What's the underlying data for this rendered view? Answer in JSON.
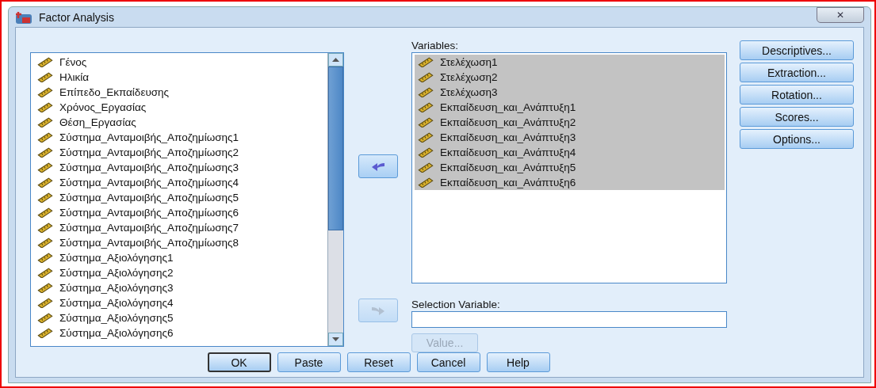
{
  "window": {
    "title": "Factor Analysis",
    "close": "✕"
  },
  "source_list": {
    "items": [
      {
        "label": "Γένος",
        "selected": false
      },
      {
        "label": "Ηλικία",
        "selected": false
      },
      {
        "label": "Επίπεδο_Εκπαίδευσης",
        "selected": false
      },
      {
        "label": "Χρόνος_Εργασίας",
        "selected": false
      },
      {
        "label": "Θέση_Εργασίας",
        "selected": false
      },
      {
        "label": "Σύστημα_Ανταμοιβής_Αποζημίωσης1",
        "selected": false
      },
      {
        "label": "Σύστημα_Ανταμοιβής_Αποζημίωσης2",
        "selected": false
      },
      {
        "label": "Σύστημα_Ανταμοιβής_Αποζημίωσης3",
        "selected": false
      },
      {
        "label": "Σύστημα_Ανταμοιβής_Αποζημίωσης4",
        "selected": false
      },
      {
        "label": "Σύστημα_Ανταμοιβής_Αποζημίωσης5",
        "selected": false
      },
      {
        "label": "Σύστημα_Ανταμοιβής_Αποζημίωσης6",
        "selected": false
      },
      {
        "label": "Σύστημα_Ανταμοιβής_Αποζημίωσης7",
        "selected": false
      },
      {
        "label": "Σύστημα_Ανταμοιβής_Αποζημίωσης8",
        "selected": false
      },
      {
        "label": "Σύστημα_Αξιολόγησης1",
        "selected": false
      },
      {
        "label": "Σύστημα_Αξιολόγησης2",
        "selected": false
      },
      {
        "label": "Σύστημα_Αξιολόγησης3",
        "selected": false
      },
      {
        "label": "Σύστημα_Αξιολόγησης4",
        "selected": false
      },
      {
        "label": "Σύστημα_Αξιολόγησης5",
        "selected": false
      },
      {
        "label": "Σύστημα_Αξιολόγησης6",
        "selected": false
      }
    ]
  },
  "move_in_button": {
    "disabled": false
  },
  "variables": {
    "label": "Variables:",
    "items": [
      {
        "label": "Στελέχωση1",
        "selected": true
      },
      {
        "label": "Στελέχωση2",
        "selected": true
      },
      {
        "label": "Στελέχωση3",
        "selected": true
      },
      {
        "label": "Εκπαίδευση_και_Ανάπτυξη1",
        "selected": true
      },
      {
        "label": "Εκπαίδευση_και_Ανάπτυξη2",
        "selected": true
      },
      {
        "label": "Εκπαίδευση_και_Ανάπτυξη3",
        "selected": true
      },
      {
        "label": "Εκπαίδευση_και_Ανάπτυξη4",
        "selected": true
      },
      {
        "label": "Εκπαίδευση_και_Ανάπτυξη5",
        "selected": true
      },
      {
        "label": "Εκπαίδευση_και_Ανάπτυξη6",
        "selected": true
      }
    ]
  },
  "side_buttons": [
    {
      "label": "Descriptives..."
    },
    {
      "label": "Extraction..."
    },
    {
      "label": "Rotation..."
    },
    {
      "label": "Scores..."
    },
    {
      "label": "Options..."
    }
  ],
  "move_selection_button": {
    "disabled": true
  },
  "selection_variable": {
    "label": "Selection Variable:",
    "value_button": {
      "label": "Value...",
      "disabled": true
    }
  },
  "buttons": [
    {
      "label": "OK",
      "default": true
    },
    {
      "label": "Paste",
      "default": false
    },
    {
      "label": "Reset",
      "default": false
    },
    {
      "label": "Cancel",
      "default": false
    },
    {
      "label": "Help",
      "default": false
    }
  ]
}
